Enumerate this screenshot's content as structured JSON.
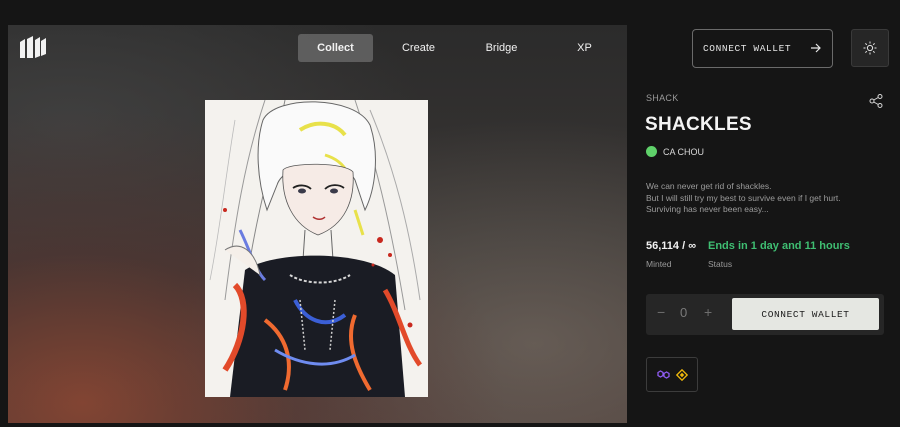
{
  "nav": {
    "items": [
      {
        "label": "Collect",
        "active": true
      },
      {
        "label": "Create",
        "active": false
      },
      {
        "label": "Bridge",
        "active": false
      },
      {
        "label": "XP",
        "active": false
      }
    ]
  },
  "header": {
    "connect_label": "CONNECT WALLET",
    "logo_icon": "brand-logo-icon",
    "theme_icon": "sun-icon"
  },
  "nft": {
    "collection": "SHACK",
    "title": "SHACKLES",
    "creator": "CA CHOU",
    "creator_dot_color": "#5fd16a",
    "description": [
      "We can never get rid of shackles.",
      "But I will still try my best to survive even if I get hurt.",
      "Surviving has never been easy..."
    ],
    "minted_value": "56,114 / ∞",
    "minted_label": "Minted",
    "status_value": "Ends in 1 day and 11 hours",
    "status_label": "Status",
    "status_color": "#3fbe72"
  },
  "mint": {
    "quantity": "0",
    "minus": "−",
    "plus": "+",
    "connect_label": "CONNECT WALLET"
  },
  "chains": [
    "polygon-icon",
    "bnb-icon"
  ]
}
